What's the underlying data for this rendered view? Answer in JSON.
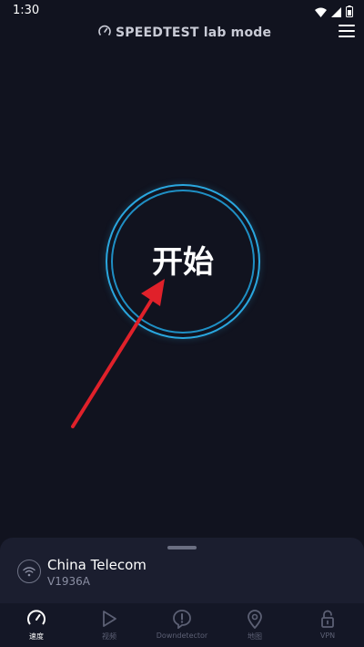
{
  "status_bar": {
    "time": "1:30"
  },
  "header": {
    "title": "SPEEDTEST lab mode"
  },
  "go_button": {
    "label": "开始"
  },
  "network": {
    "provider": "China Telecom",
    "server": "V1936A"
  },
  "nav": {
    "items": [
      {
        "label": "速度",
        "icon": "speedometer-icon",
        "active": true
      },
      {
        "label": "视频",
        "icon": "play-icon",
        "active": false
      },
      {
        "label": "Downdetector",
        "icon": "alert-icon",
        "active": false
      },
      {
        "label": "地图",
        "icon": "map-pin-icon",
        "active": false
      },
      {
        "label": "VPN",
        "icon": "lock-icon",
        "active": false
      }
    ]
  },
  "colors": {
    "background": "#11131f",
    "ring": "#2aa7df",
    "annotation_arrow": "#e0212a",
    "active_nav": "#ffffff",
    "inactive_nav": "#5c6074"
  }
}
